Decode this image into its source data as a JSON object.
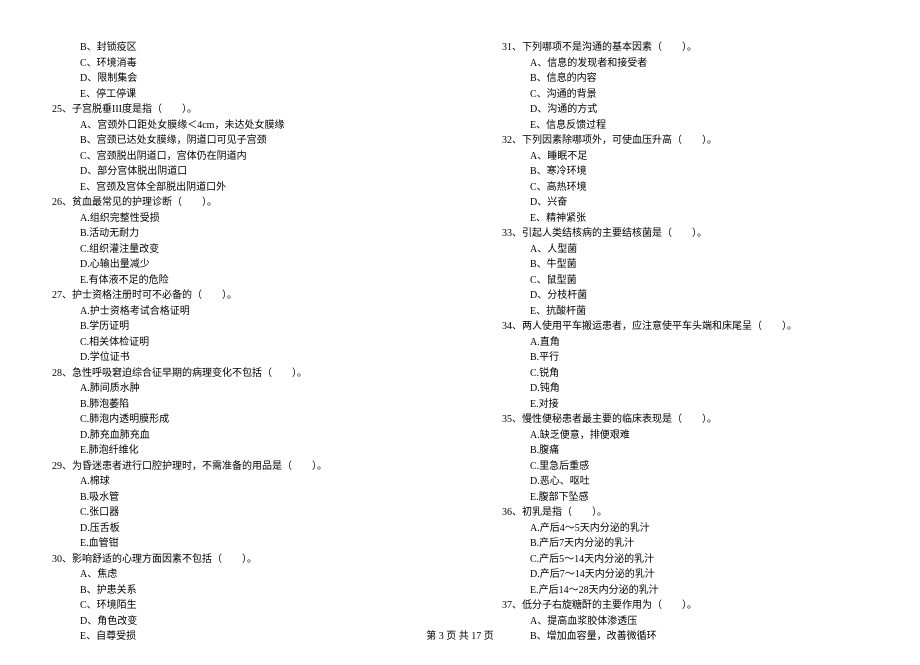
{
  "left": {
    "opts24": [
      "B、封锁疫区",
      "C、环境消毒",
      "D、限制集会",
      "E、停工停课"
    ],
    "q25": "25、子宫脱垂III度是指（　　）。",
    "opts25": [
      "A、宫颈外口距处女膜缘＜4cm，未达处女膜缘",
      "B、宫颈已达处女膜缘，阴道口可见子宫颈",
      "C、宫颈脱出阴道口，宫体仍在阴道内",
      "D、部分宫体脱出阴道口",
      "E、宫颈及宫体全部脱出阴道口外"
    ],
    "q26": "26、贫血最常见的护理诊断（　　）。",
    "opts26": [
      "A.组织完整性受损",
      "B.活动无耐力",
      "C.组织灌注量改变",
      "D.心输出量减少",
      "E.有体液不足的危险"
    ],
    "q27": "27、护士资格注册时可不必备的（　　）。",
    "opts27": [
      "A.护士资格考试合格证明",
      "B.学历证明",
      "C.相关体检证明",
      "D.学位证书"
    ],
    "q28": "28、急性呼吸窘迫综合征早期的病理变化不包括（　　）。",
    "opts28": [
      "A.肺间质水肿",
      "B.肺泡萎陷",
      "C.肺泡内透明膜形成",
      "D.肺充血肺充血",
      "E.肺泡纤维化"
    ],
    "q29": "29、为昏迷患者进行口腔护理时，不需准备的用品是（　　）。",
    "opts29": [
      "A.棉球",
      "B.吸水管",
      "C.张口器",
      "D.压舌板",
      "E.血管钳"
    ],
    "q30": "30、影响舒适的心理方面因素不包括（　　）。",
    "opts30": [
      "A、焦虑",
      "B、护患关系",
      "C、环境陌生",
      "D、角色改变",
      "E、自尊受损"
    ]
  },
  "right": {
    "q31": "31、下列哪项不是沟通的基本因素（　　）。",
    "opts31": [
      "A、信息的发现者和接受者",
      "B、信息的内容",
      "C、沟通的背景",
      "D、沟通的方式",
      "E、信息反馈过程"
    ],
    "q32": "32、下列因素除哪项外，可使血压升高（　　）。",
    "opts32": [
      "A、睡眠不足",
      "B、寒冷环境",
      "C、高热环境",
      "D、兴奋",
      "E、精神紧张"
    ],
    "q33": "33、引起人类结核病的主要结核菌是（　　）。",
    "opts33": [
      "A、人型菌",
      "B、牛型菌",
      "C、鼠型菌",
      "D、分枝杆菌",
      "E、抗酸杆菌"
    ],
    "q34": "34、两人使用平车搬运患者，应注意使平车头端和床尾呈（　　）。",
    "opts34": [
      "A.直角",
      "B.平行",
      "C.锐角",
      "D.钝角",
      "E.对接"
    ],
    "q35": "35、慢性便秘患者最主要的临床表现是（　　）。",
    "opts35": [
      "A.缺乏便意，排便艰难",
      "B.腹痛",
      "C.里急后重感",
      "D.恶心、呕吐",
      "E.腹部下坠感"
    ],
    "q36": "36、初乳是指（　　）。",
    "opts36": [
      "A.产后4～5天内分泌的乳汁",
      "B.产后7天内分泌的乳汁",
      "C.产后5～14天内分泌的乳汁",
      "D.产后7～14天内分泌的乳汁",
      "E.产后14～28天内分泌的乳汁"
    ],
    "q37": "37、低分子右旋糖酐的主要作用为（　　）。",
    "opts37": [
      "A、提高血浆胶体渗透压",
      "B、增加血容量，改善微循环"
    ]
  },
  "footer": "第 3 页 共 17 页"
}
